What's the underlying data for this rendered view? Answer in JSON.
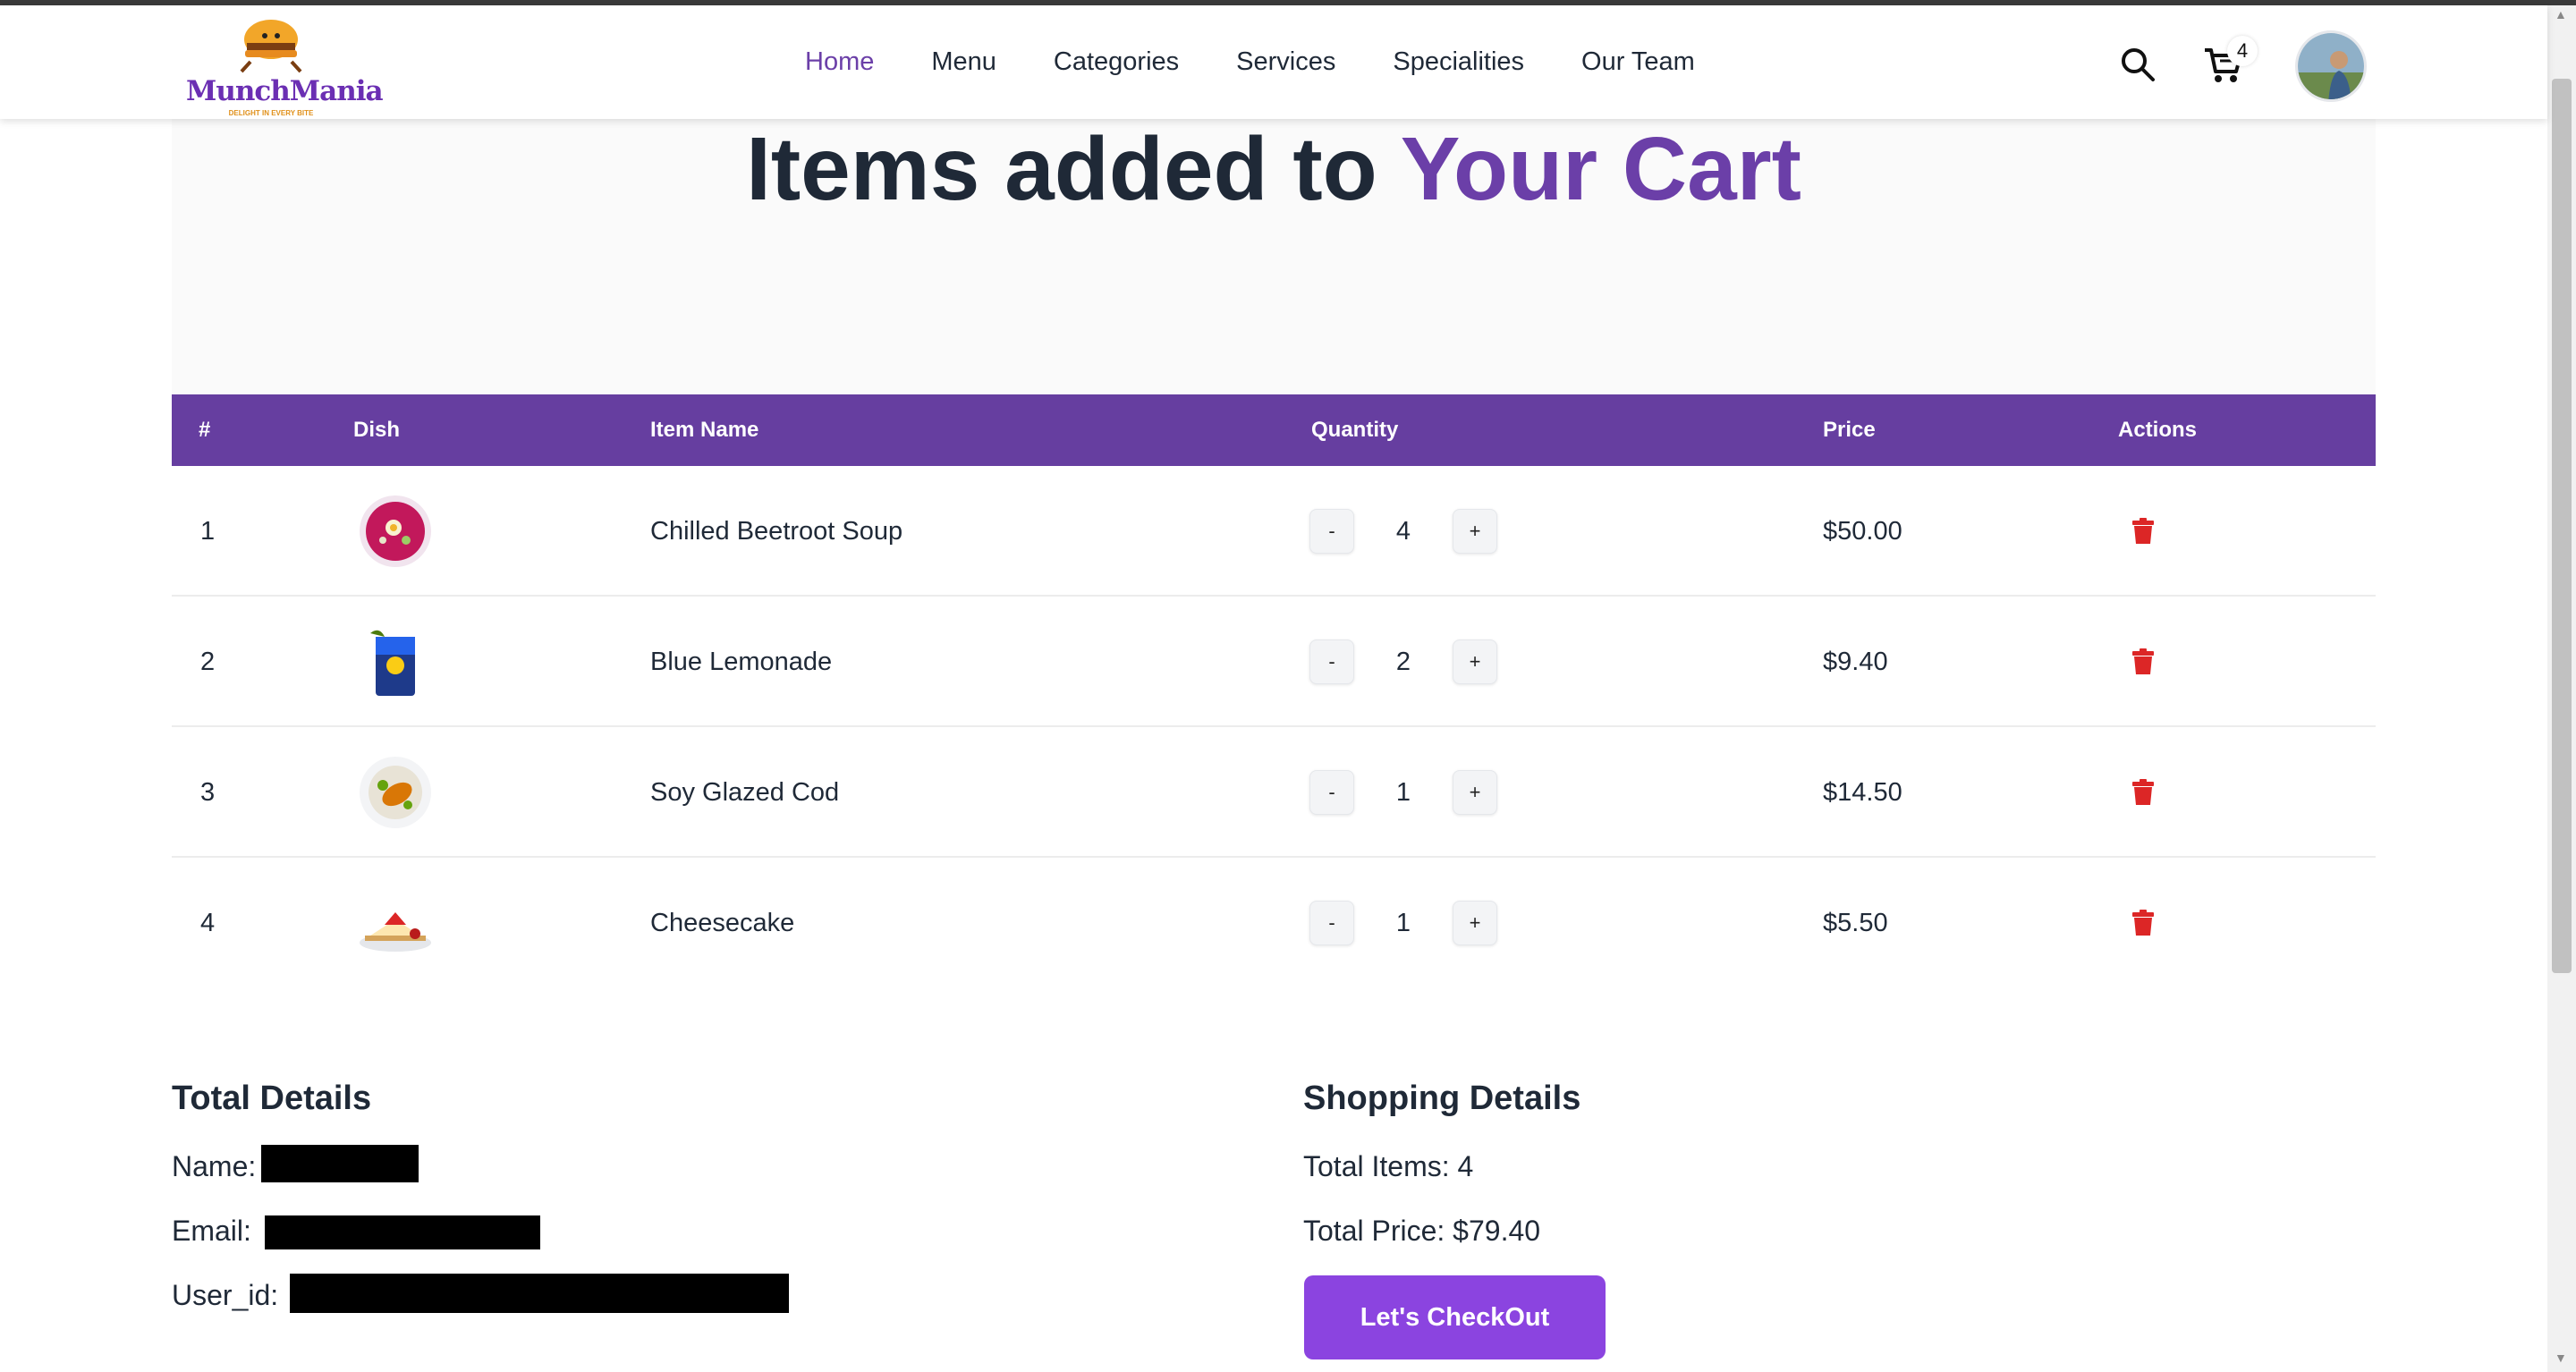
{
  "brand": {
    "name": "MunchMania",
    "tagline": "DELIGHT IN EVERY BITE"
  },
  "nav": {
    "links": [
      "Home",
      "Menu",
      "Categories",
      "Services",
      "Specialities",
      "Our Team"
    ],
    "active": "Home",
    "cart_count": "4"
  },
  "hero": {
    "title_main": "Items added to ",
    "title_accent": "Your Cart"
  },
  "table": {
    "headers": [
      "#",
      "Dish",
      "Item Name",
      "Quantity",
      "Price",
      "Actions"
    ],
    "rows": [
      {
        "index": "1",
        "name": "Chilled Beetroot Soup",
        "qty": "4",
        "price": "$50.00",
        "dish_icon": "beetroot-soup-bowl"
      },
      {
        "index": "2",
        "name": "Blue Lemonade",
        "qty": "2",
        "price": "$9.40",
        "dish_icon": "blue-lemonade-glass"
      },
      {
        "index": "3",
        "name": "Soy Glazed Cod",
        "qty": "1",
        "price": "$14.50",
        "dish_icon": "cod-plate"
      },
      {
        "index": "4",
        "name": "Cheesecake",
        "qty": "1",
        "price": "$5.50",
        "dish_icon": "cheesecake-slice"
      }
    ],
    "minus_label": "-",
    "plus_label": "+"
  },
  "total_details": {
    "title": "Total Details",
    "name_label": "Name:",
    "email_label": "Email:",
    "user_id_label": "User_id:"
  },
  "shopping_details": {
    "title": "Shopping Details",
    "total_items": "Total Items: 4",
    "total_price": "Total Price: $79.40",
    "checkout_label": "Let's CheckOut"
  },
  "colors": {
    "accent": "#6b3fa8",
    "header_bg": "#663ea0",
    "button": "#8b44e0",
    "delete": "#dc2626"
  }
}
